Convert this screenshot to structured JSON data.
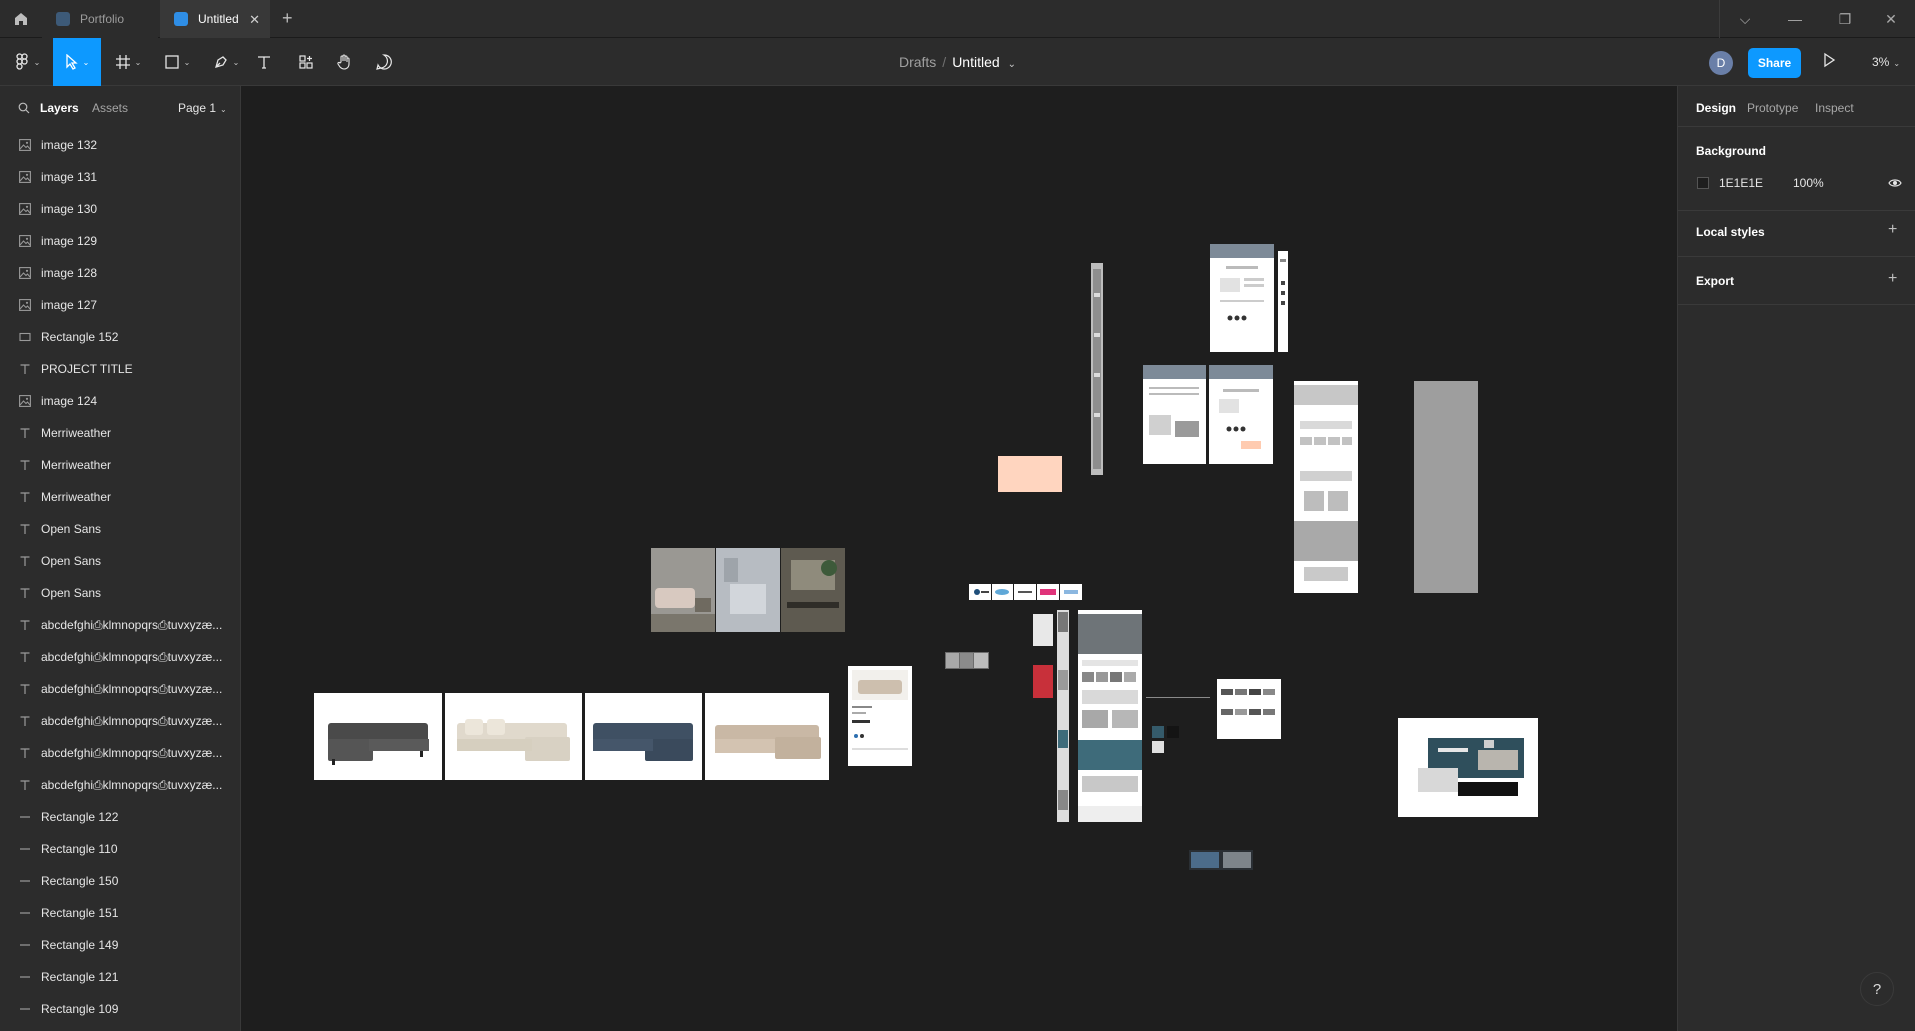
{
  "tabs": {
    "items": [
      {
        "label": "Portfolio"
      },
      {
        "label": "Untitled",
        "close": "✕"
      }
    ],
    "new_tab": "+"
  },
  "window_controls": {
    "chevron": "⌵",
    "minimize": "—",
    "restore": "❐",
    "close": "✕"
  },
  "toolbar": {
    "breadcrumb": {
      "folder": "Drafts",
      "separator": "/",
      "file": "Untitled",
      "caret": "⌄"
    },
    "avatar_initial": "D",
    "share_label": "Share",
    "zoom": "3%",
    "caret": "⌄"
  },
  "left_panel": {
    "tabs": {
      "layers": "Layers",
      "assets": "Assets"
    },
    "page": "Page 1",
    "page_caret": "⌄",
    "layers": [
      {
        "name": "image 132",
        "icon": "image-icon"
      },
      {
        "name": "image 131",
        "icon": "image-icon"
      },
      {
        "name": "image 130",
        "icon": "image-icon"
      },
      {
        "name": "image 129",
        "icon": "image-icon"
      },
      {
        "name": "image 128",
        "icon": "image-icon"
      },
      {
        "name": "image 127",
        "icon": "image-icon"
      },
      {
        "name": "Rectangle 152",
        "icon": "rectangle-icon"
      },
      {
        "name": "PROJECT TITLE",
        "icon": "text-icon"
      },
      {
        "name": "image 124",
        "icon": "image-icon"
      },
      {
        "name": "Merriweather",
        "icon": "text-icon"
      },
      {
        "name": "Merriweather",
        "icon": "text-icon"
      },
      {
        "name": "Merriweather",
        "icon": "text-icon"
      },
      {
        "name": "Open Sans",
        "icon": "text-icon"
      },
      {
        "name": "Open Sans",
        "icon": "text-icon"
      },
      {
        "name": "Open Sans",
        "icon": "text-icon"
      },
      {
        "name": "abcdefghi⎙klmnopqrs⎙tuvxyzæ...",
        "icon": "text-icon"
      },
      {
        "name": "abcdefghi⎙klmnopqrs⎙tuvxyzæ...",
        "icon": "text-icon"
      },
      {
        "name": "abcdefghi⎙klmnopqrs⎙tuvxyzæ...",
        "icon": "text-icon"
      },
      {
        "name": "abcdefghi⎙klmnopqrs⎙tuvxyzæ...",
        "icon": "text-icon"
      },
      {
        "name": "abcdefghi⎙klmnopqrs⎙tuvxyzæ...",
        "icon": "text-icon"
      },
      {
        "name": "abcdefghi⎙klmnopqrs⎙tuvxyzæ...",
        "icon": "text-icon"
      },
      {
        "name": "Rectangle 122",
        "icon": "line-icon"
      },
      {
        "name": "Rectangle 110",
        "icon": "line-icon"
      },
      {
        "name": "Rectangle 150",
        "icon": "line-icon"
      },
      {
        "name": "Rectangle 151",
        "icon": "line-icon"
      },
      {
        "name": "Rectangle 149",
        "icon": "line-icon"
      },
      {
        "name": "Rectangle 121",
        "icon": "line-icon"
      },
      {
        "name": "Rectangle 109",
        "icon": "line-icon"
      }
    ]
  },
  "right_panel": {
    "tabs": {
      "design": "Design",
      "prototype": "Prototype",
      "inspect": "Inspect"
    },
    "background": {
      "heading": "Background",
      "hex": "1E1E1E",
      "opacity": "100%",
      "swatch_color": "#1E1E1E"
    },
    "local_styles": "Local styles",
    "export": "Export",
    "plus": "+"
  },
  "help": "?",
  "colors": {
    "accent": "#0D99FF",
    "panel": "#2C2C2C",
    "canvas": "#1E1E1E",
    "peach": "#FFD5BF",
    "red": "#C8303A"
  }
}
